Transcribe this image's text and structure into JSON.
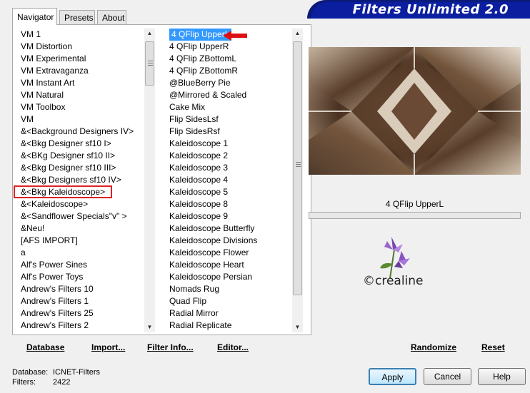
{
  "tabs": [
    "Navigator",
    "Presets",
    "About"
  ],
  "title": "Filters Unlimited 2.0",
  "categories": [
    "VM 1",
    "VM Distortion",
    "VM Experimental",
    "VM Extravaganza",
    "VM Instant Art",
    "VM Natural",
    "VM Toolbox",
    "VM",
    "&<Background Designers IV>",
    "&<Bkg Designer sf10 I>",
    "&<BKg Designer sf10 II>",
    "&<Bkg Designer sf10 III>",
    "&<Bkg Designers sf10 IV>",
    "&<Bkg Kaleidoscope>",
    "&<Kaleidoscope>",
    "&<Sandflower Specials\"v\" >",
    "&Neu!",
    "[AFS IMPORT]",
    "a",
    "Alf's Power Sines",
    "Alf's Power Toys",
    "Andrew's Filters 10",
    "Andrew's Filters 1",
    "Andrew's Filters 25",
    "Andrew's Filters 2"
  ],
  "selected_category_index": 13,
  "filters": [
    "4 QFlip UpperL",
    "4 QFlip UpperR",
    "4 QFlip ZBottomL",
    "4 QFlip ZBottomR",
    "@BlueBerry Pie",
    "@Mirrored & Scaled",
    "Cake Mix",
    "Flip SidesLsf",
    "Flip SidesRsf",
    "Kaleidoscope 1",
    "Kaleidoscope 2",
    "Kaleidoscope 3",
    "Kaleidoscope 4",
    "Kaleidoscope 5",
    "Kaleidoscope 8",
    "Kaleidoscope 9",
    "Kaleidoscope Butterfly",
    "Kaleidoscope Divisions",
    "Kaleidoscope Flower",
    "Kaleidoscope Heart",
    "Kaleidoscope Persian",
    "Nomads Rug",
    "Quad Flip",
    "Radial Mirror",
    "Radial Replicate"
  ],
  "selected_filter_index": 0,
  "preview_label": "4 QFlip UpperL",
  "watermark": "©crealine",
  "buttons": {
    "database": "Database",
    "import": "Import...",
    "filter_info": "Filter Info...",
    "editor": "Editor...",
    "randomize": "Randomize",
    "reset": "Reset",
    "apply": "Apply",
    "cancel": "Cancel",
    "help": "Help"
  },
  "status": {
    "database_label": "Database:",
    "database_value": "ICNET-Filters",
    "filters_label": "Filters:",
    "filters_value": "2422"
  },
  "colors": {
    "selection": "#3399ff",
    "highlight_box": "#dd2222",
    "banner": "#0c1ea0"
  },
  "icons": {
    "scroll_up": "up-arrow-icon",
    "scroll_down": "down-arrow-icon",
    "pointer": "red-arrow-icon"
  }
}
